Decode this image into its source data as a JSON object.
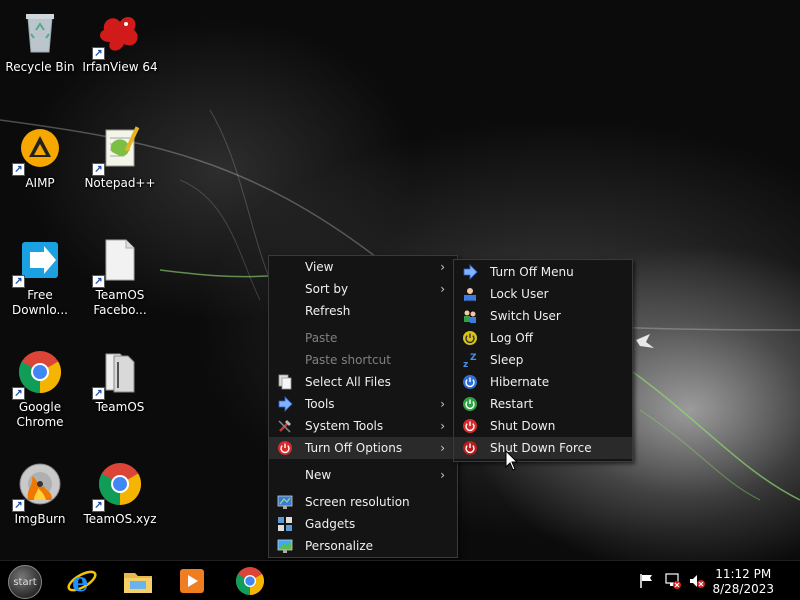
{
  "desktop": {
    "icons": [
      {
        "label": "Recycle Bin",
        "icon": "recycle-bin-icon"
      },
      {
        "label": "IrfanView 64",
        "icon": "irfanview-icon"
      },
      {
        "label": "AIMP",
        "icon": "aimp-icon"
      },
      {
        "label": "Notepad++",
        "icon": "notepad-plus-plus-icon"
      },
      {
        "label": "Free Downlo...",
        "icon": "free-download-manager-icon"
      },
      {
        "label": "TeamOS Facebo...",
        "icon": "document-icon"
      },
      {
        "label": "Google Chrome",
        "icon": "chrome-icon"
      },
      {
        "label": "TeamOS",
        "icon": "folder-icon"
      },
      {
        "label": "ImgBurn",
        "icon": "imgburn-icon"
      },
      {
        "label": "TeamOS.xyz",
        "icon": "chrome-icon"
      }
    ]
  },
  "context_menu": {
    "items": [
      {
        "label": "View",
        "submenu": true
      },
      {
        "label": "Sort by",
        "submenu": true
      },
      {
        "label": "Refresh"
      },
      {
        "label": "Paste",
        "disabled": true
      },
      {
        "label": "Paste shortcut",
        "disabled": true
      },
      {
        "label": "Select All Files",
        "icon": "files-icon"
      },
      {
        "label": "Tools",
        "icon": "arrow-right-icon",
        "submenu": true
      },
      {
        "label": "System Tools",
        "icon": "tools-icon",
        "submenu": true
      },
      {
        "label": "Turn Off Options",
        "icon": "power-icon",
        "submenu": true
      },
      {
        "label": "New",
        "submenu": true
      },
      {
        "label": "Screen resolution",
        "icon": "monitor-icon"
      },
      {
        "label": "Gadgets",
        "icon": "gadgets-icon"
      },
      {
        "label": "Personalize",
        "icon": "personalize-icon"
      }
    ]
  },
  "turn_off_submenu": {
    "items": [
      {
        "label": "Turn Off Menu",
        "icon": "arrow-right-icon"
      },
      {
        "label": "Lock User",
        "icon": "lock-icon"
      },
      {
        "label": "Switch User",
        "icon": "switch-user-icon"
      },
      {
        "label": "Log Off",
        "icon": "log-off-icon"
      },
      {
        "label": "Sleep",
        "icon": "sleep-icon"
      },
      {
        "label": "Hibernate",
        "icon": "hibernate-icon"
      },
      {
        "label": "Restart",
        "icon": "restart-icon"
      },
      {
        "label": "Shut Down",
        "icon": "shut-down-icon"
      },
      {
        "label": "Shut Down Force",
        "icon": "shut-down-force-icon"
      }
    ]
  },
  "taskbar": {
    "start_label": "start",
    "pinned": [
      "internet-explorer-icon",
      "file-explorer-icon",
      "media-player-icon",
      "chrome-icon"
    ],
    "tray": [
      "action-center-flag-icon",
      "network-icon",
      "volume-muted-icon"
    ],
    "clock_time": "11:12 PM",
    "clock_date": "8/28/2023"
  }
}
